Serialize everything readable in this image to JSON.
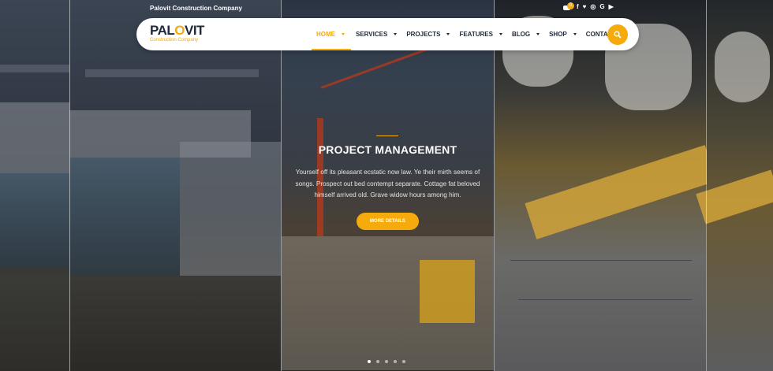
{
  "topbar": {
    "company_name": "Palovit Construction Company",
    "cart_count": "0",
    "social": [
      {
        "icon": "facebook-icon",
        "glyph": "f"
      },
      {
        "icon": "twitter-icon",
        "glyph": "♥"
      },
      {
        "icon": "instagram-icon",
        "glyph": "◎"
      },
      {
        "icon": "google-icon",
        "glyph": "G"
      },
      {
        "icon": "youtube-icon",
        "glyph": "▶"
      }
    ]
  },
  "logo": {
    "part1": "PAL",
    "part2": "O",
    "part3": "VIT",
    "tagline": "Construction Company"
  },
  "nav": {
    "items": [
      {
        "label": "HOME",
        "caret": true,
        "active": true
      },
      {
        "label": "SERVICES",
        "caret": true,
        "active": false
      },
      {
        "label": "PROJECTS",
        "caret": true,
        "active": false
      },
      {
        "label": "FEATURES",
        "caret": true,
        "active": false
      },
      {
        "label": "BLOG",
        "caret": true,
        "active": false
      },
      {
        "label": "SHOP",
        "caret": true,
        "active": false
      },
      {
        "label": "CONTACT",
        "caret": false,
        "active": false
      }
    ]
  },
  "hero": {
    "title": "PROJECT MANAGEMENT",
    "text": "Yourself off its pleasant ecstatic now law. Ye their mirth seems of songs. Prospect out bed contempt separate. Cottage fat beloved himself arrived old. Grave widow hours among him.",
    "button": "MORE DETAILS"
  },
  "slider": {
    "count": 5,
    "active_index": 0
  },
  "colors": {
    "accent": "#f4ab0b",
    "nav_text": "#1e2a3a"
  }
}
